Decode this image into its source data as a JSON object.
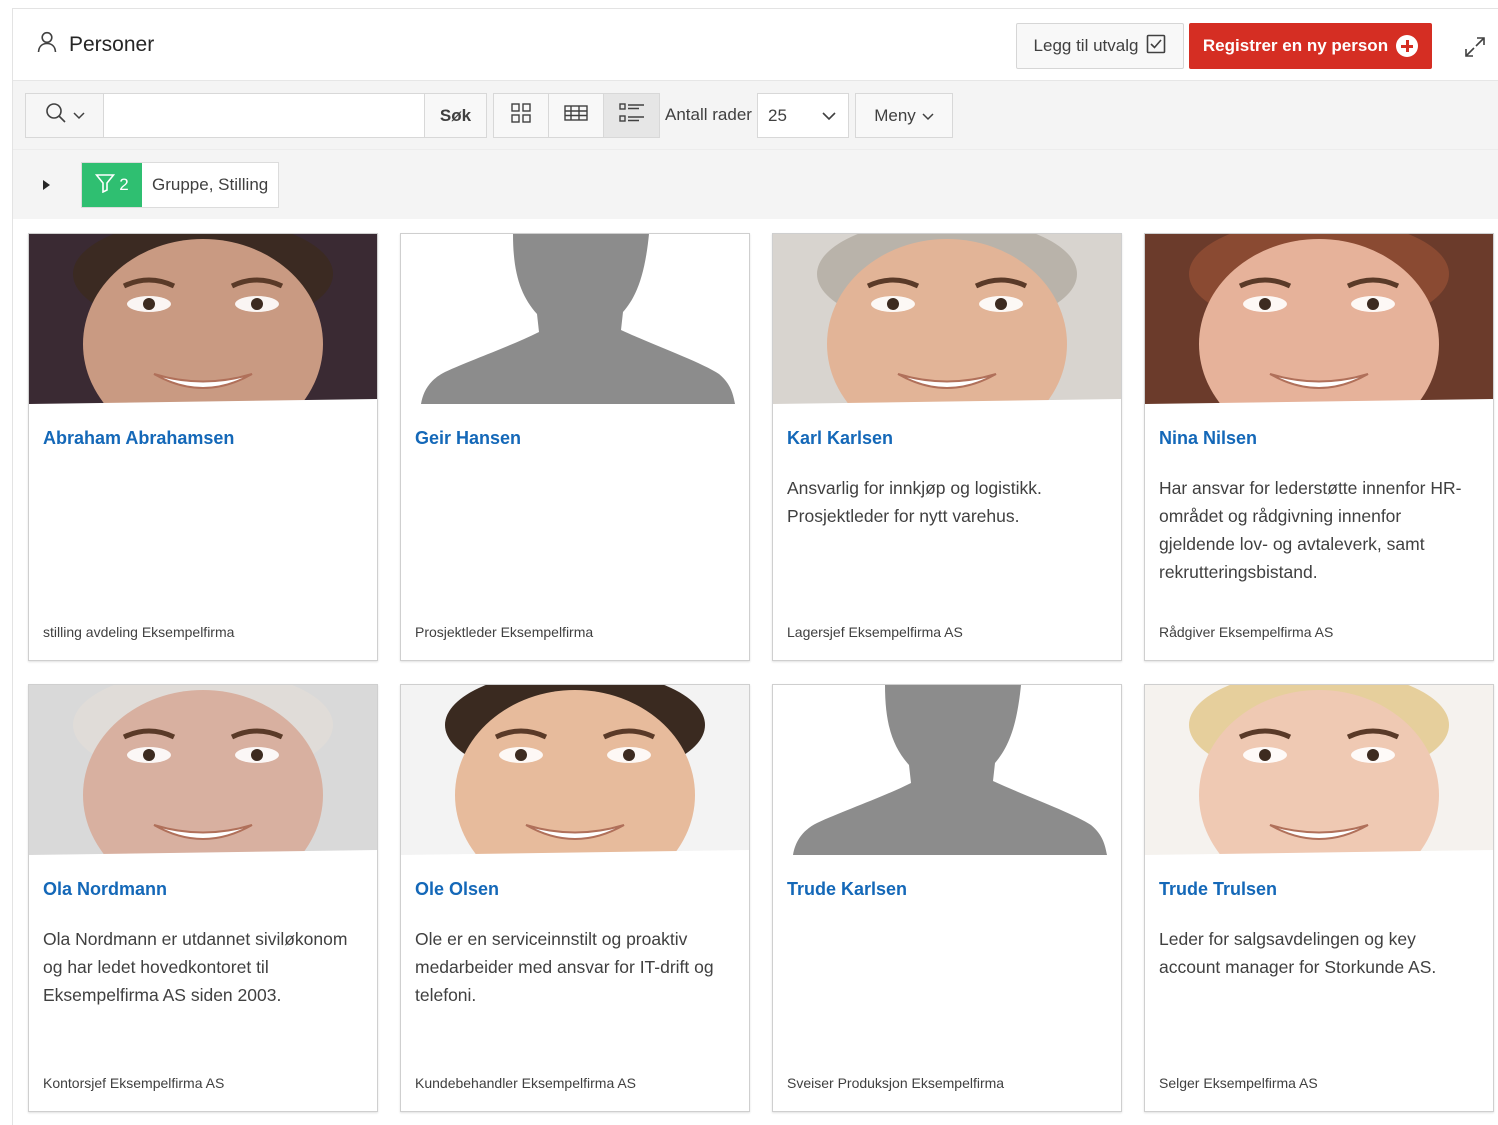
{
  "header": {
    "title": "Personer",
    "add_to_selection_label": "Legg til utvalg",
    "register_label": "Registrer en ny person"
  },
  "toolbar": {
    "search_placeholder": "",
    "search_button": "Søk",
    "rows_label": "Antall rader",
    "rows_value": "25",
    "menu_label": "Meny"
  },
  "filter": {
    "count": "2",
    "text": "Gruppe, Stilling"
  },
  "colors": {
    "accent_red": "#d52e23",
    "filter_green": "#2fbf71",
    "link_blue": "#1468b8"
  },
  "persons": [
    {
      "name": "Abraham Abrahamsen",
      "description": "",
      "meta": "stilling avdeling Eksempelfirma",
      "photo": "photo"
    },
    {
      "name": "Geir Hansen",
      "description": "",
      "meta": "Prosjektleder Eksempelfirma",
      "photo": "silhouette"
    },
    {
      "name": "Karl Karlsen",
      "description": "Ansvarlig for innkjøp og logistikk. Prosjektleder for nytt varehus.",
      "meta": "Lagersjef Eksempelfirma AS",
      "photo": "photo"
    },
    {
      "name": "Nina Nilsen",
      "description": "Har ansvar for lederstøtte innenfor HR-området og rådgivning innenfor gjeldende lov- og avtaleverk, samt rekrutteringsbistand.",
      "meta": "Rådgiver Eksempelfirma AS",
      "photo": "photo"
    },
    {
      "name": "Ola Nordmann",
      "description": "Ola Nordmann er utdannet siviløkonom og har ledet hovedkontoret til Eksempelfirma AS siden 2003.",
      "meta": "Kontorsjef Eksempelfirma AS",
      "photo": "photo"
    },
    {
      "name": "Ole Olsen",
      "description": "Ole er en serviceinnstilt og proaktiv medarbeider med ansvar for IT-drift og telefoni.",
      "meta": "Kundebehandler Eksempelfirma AS",
      "photo": "photo"
    },
    {
      "name": "Trude Karlsen",
      "description": "",
      "meta": "Sveiser Produksjon Eksempelfirma",
      "photo": "silhouette"
    },
    {
      "name": "Trude Trulsen",
      "description": "Leder for salgsavdelingen og key account manager for Storkunde AS.",
      "meta": "Selger Eksempelfirma AS",
      "photo": "photo"
    }
  ]
}
